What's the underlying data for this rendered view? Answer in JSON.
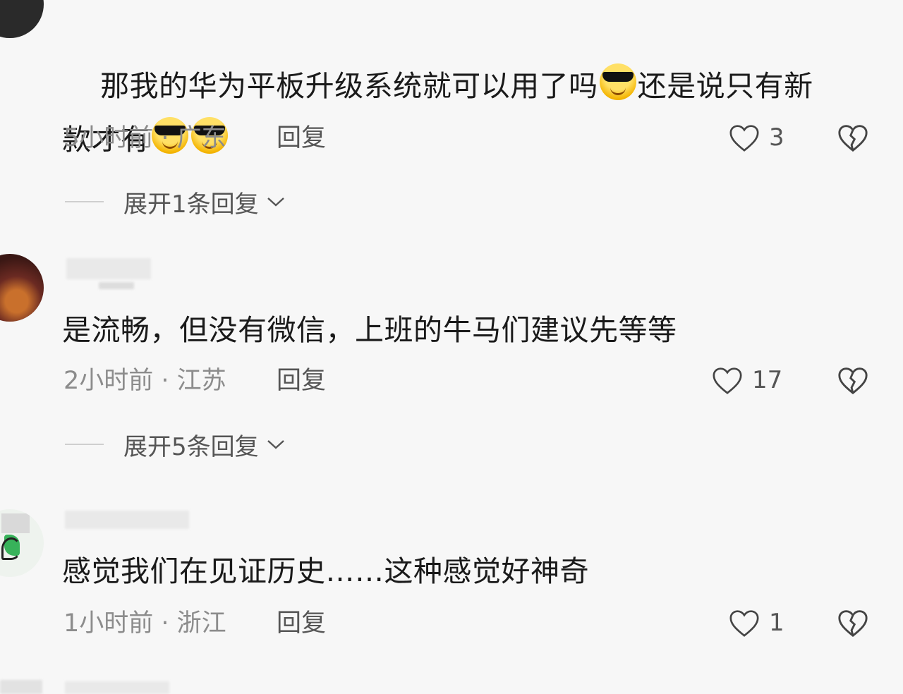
{
  "comments": [
    {
      "text_line1": "那我的华为平板升级系统就可以用了吗",
      "text_mid": "还是说只有新",
      "text_line2": "款才有",
      "time_location": "5小时前 · 广东",
      "reply_label": "回复",
      "likes": "3",
      "expand_label": "展开1条回复",
      "emoji": "cool-face-emoji"
    },
    {
      "text": "是流畅，但没有微信，上班的牛马们建议先等等",
      "time_location": "2小时前 · 江苏",
      "reply_label": "回复",
      "likes": "17",
      "expand_label": "展开5条回复"
    },
    {
      "text": "感觉我们在见证历史……这种感觉好神奇",
      "time_location": "1小时前 · 浙江",
      "reply_label": "回复",
      "likes": "1"
    }
  ],
  "colors": {
    "background": "#f7f7f7",
    "text": "#1a1a1a",
    "meta": "#8c8c8c",
    "icon": "#555555"
  },
  "icons": {
    "like": "heart-outline-icon",
    "dislike": "broken-heart-icon",
    "expand": "chevron-down-icon"
  }
}
